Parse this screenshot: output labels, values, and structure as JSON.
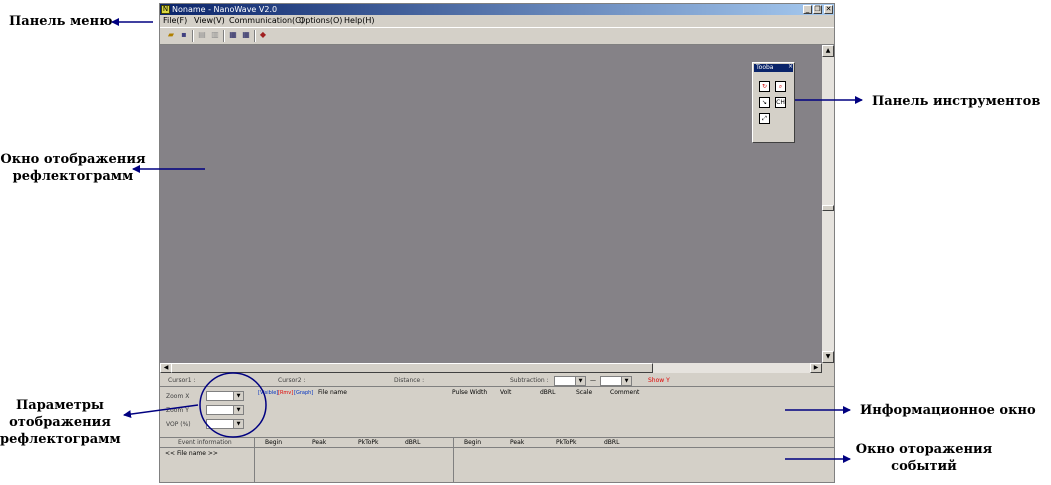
{
  "annotations": {
    "menu_panel": "Панель меню",
    "toolbar_panel": "Панель инструментов",
    "display_window": [
      "Окно отображения",
      "рефлектограмм"
    ],
    "info_window": "Информационное окно",
    "params": [
      "Параметры",
      "отображения",
      "рефлектограмм"
    ],
    "events_window": [
      "Окно отоpажения",
      "событий"
    ]
  },
  "window": {
    "title": "Noname - NanoWave V2.0",
    "icon_letter": "N",
    "minimize": "_",
    "restore": "❐",
    "close": "✕"
  },
  "menu": {
    "file": "File(F)",
    "view": "View(V)",
    "communication": "Communication(C)",
    "options": "Options(O)",
    "help": "Help(H)"
  },
  "toolbar_icons": [
    "open-icon",
    "save-icon",
    "print-icon",
    "print-preview-icon",
    "window-icon",
    "window-list-icon",
    "settings-icon"
  ],
  "toolbox": {
    "title": "Tooba",
    "close": "×",
    "ch_label": "CH"
  },
  "status": {
    "cursor1": "Cursor1 :",
    "cursor2": "Cursor2 :",
    "distance": "Distance :",
    "subtraction": "Subtraction :",
    "dash": "—",
    "show_y": "Show Y"
  },
  "params": {
    "zoom_x": "Zoom X",
    "zoom_y": "Zoom Y",
    "vop": "VOP (%)"
  },
  "info": {
    "visible": "[Visible]",
    "rmv": "[Rmv]",
    "graph": "[Graph]",
    "file_name": "File name",
    "pulse_width": "Pulse Width",
    "volt": "Volt",
    "dbrl": "dBRL",
    "scale": "Scale",
    "comment": "Comment"
  },
  "events": {
    "event_information": "Event information",
    "file_name_row": "<< File name >>",
    "left": {
      "begin": "Begin",
      "peak": "Peak",
      "pktopk": "PkToPk",
      "dbrl": "dBRL"
    },
    "right": {
      "begin": "Begin",
      "peak": "Peak",
      "pktopk": "PkToPk",
      "dbrl": "dBRL"
    }
  },
  "colors": {
    "arrow": "#000080",
    "circle": "#000080",
    "display_bg": "#858287",
    "titlebar": "#0a246a"
  }
}
